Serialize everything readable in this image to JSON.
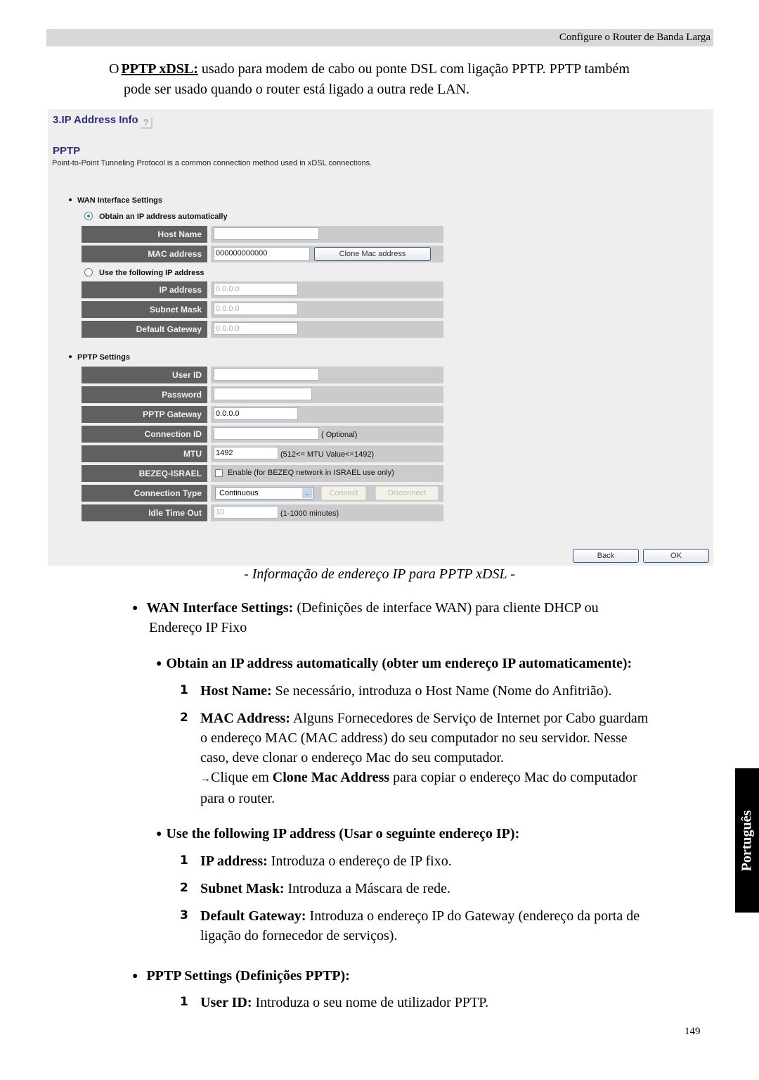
{
  "header": {
    "title": "Configure o Router de Banda Larga"
  },
  "intro": {
    "bullet": "O",
    "term": "PPTP xDSL:",
    "line1": " usado para modem de cabo ou ponte DSL com ligação PPTP. PPTP também",
    "line2": "pode ser usado quando o router está ligado a outra rede LAN."
  },
  "screenshot": {
    "title": "3.IP Address Info",
    "help_icon": "help-icon",
    "section_title": "PPTP",
    "section_desc": "Point-to-Point Tunneling Protocol is a common connection method used in xDSL connections.",
    "wan_heading": "WAN Interface Settings",
    "radio_auto": {
      "label": "Obtain an IP address automatically",
      "checked": true
    },
    "radio_static": {
      "label": "Use the following IP address",
      "checked": false
    },
    "fields": {
      "host_name": {
        "label": "Host Name",
        "value": ""
      },
      "mac_address": {
        "label": "MAC address",
        "value": "000000000000",
        "button": "Clone Mac address"
      },
      "ip_address": {
        "label": "IP address",
        "value": "0.0.0.0"
      },
      "subnet_mask": {
        "label": "Subnet Mask",
        "value": "0.0.0.0"
      },
      "default_gateway": {
        "label": "Default Gateway",
        "value": "0.0.0.0"
      }
    },
    "pptp_heading": "PPTP Settings",
    "pptp": {
      "user_id": {
        "label": "User ID",
        "value": ""
      },
      "password": {
        "label": "Password",
        "value": ""
      },
      "pptp_gateway": {
        "label": "PPTP Gateway",
        "value": "0.0.0.0"
      },
      "connection_id": {
        "label": "Connection ID",
        "value": "",
        "note": "( Optional)"
      },
      "mtu": {
        "label": "MTU",
        "value": "1492",
        "note": "(512<= MTU Value<=1492)"
      },
      "bezeq": {
        "label": "BEZEQ-ISRAEL",
        "checked": false,
        "note": "Enable (for BEZEQ network in ISRAEL use only)"
      },
      "connection_type": {
        "label": "Connection Type",
        "selected": "Continuous",
        "connect": "Connect",
        "disconnect": "Disconnect"
      },
      "idle_time_out": {
        "label": "Idle Time Out",
        "value": "10",
        "note": "(1-1000 minutes)"
      }
    },
    "back_button": "Back",
    "ok_button": "OK"
  },
  "caption": "- Informação de endereço IP para PPTP xDSL -",
  "body": {
    "wan": {
      "bullet": "●",
      "term": "WAN Interface Settings:",
      "text1": " (Definições de interface WAN) para cliente DHCP ou",
      "text2": "Endereço IP Fixo"
    },
    "obtain": {
      "bullet": "●",
      "heading": "Obtain an IP address automatically (obter um endereço IP automaticamente):"
    },
    "obtain_items": [
      {
        "num": "1",
        "term": "Host Name:",
        "text": " Se necessário, introduza o Host Name (Nome do Anfitrião)."
      },
      {
        "num": "2",
        "term": "MAC Address:",
        "text": " Alguns Fornecedores de Serviço de Internet por Cabo guardam",
        "line2": "o endereço MAC (MAC address) do seu computador no seu servidor. Nesse",
        "line3": "caso, deve clonar o endereço Mac do seu computador.",
        "arrow": "→",
        "line4a": "Clique em ",
        "line4b": "Clone Mac Address",
        "line4c": " para copiar o endereço Mac do computador",
        "line5": "para o router."
      }
    ],
    "use": {
      "bullet": "●",
      "heading": "Use the following IP address (Usar o seguinte endereço IP):"
    },
    "use_items": [
      {
        "num": "1",
        "term": "IP address:",
        "text": " Introduza o endereço de IP fixo."
      },
      {
        "num": "2",
        "term": "Subnet Mask:",
        "text": " Introduza a Máscara de rede."
      },
      {
        "num": "3",
        "term": "Default Gateway:",
        "text": " Introduza o endereço IP do Gateway (endereço da porta de",
        "line2": "ligação do fornecedor de serviços)."
      }
    ],
    "pptp": {
      "bullet": "●",
      "heading": "PPTP Settings (Definições PPTP):"
    },
    "pptp_items": [
      {
        "num": "1",
        "term": "User ID:",
        "text": " Introduza o seu nome de utilizador PPTP."
      }
    ]
  },
  "side_tab": "Português",
  "page_number": "149"
}
